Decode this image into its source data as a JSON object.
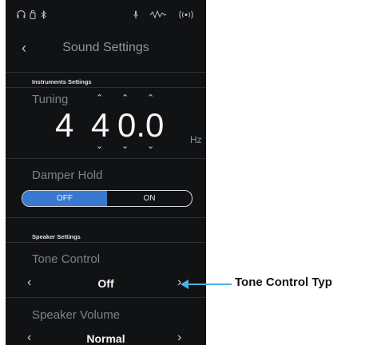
{
  "status_bar": {
    "icons": [
      "headphones-icon",
      "usb-icon",
      "bluetooth-icon",
      "microphone-icon",
      "sound-mode-icon",
      "wireless-icon"
    ]
  },
  "header": {
    "title": "Sound Settings",
    "back_icon": "chevron-left-icon"
  },
  "instruments_settings": {
    "section_label": "Instruments Settings",
    "tuning": {
      "label": "Tuning",
      "digits": [
        "4",
        "4",
        "0.0"
      ],
      "unit": "Hz"
    },
    "damper_hold": {
      "label": "Damper Hold",
      "options": [
        "OFF",
        "ON"
      ],
      "selected": "OFF"
    }
  },
  "speaker_settings": {
    "section_label": "Speaker Settings",
    "tone_control": {
      "label": "Tone Control",
      "value": "Off"
    },
    "speaker_volume": {
      "label": "Speaker Volume",
      "value": "Normal"
    }
  },
  "annotation": {
    "text": "Tone Control Typ"
  },
  "colors": {
    "accent": "#3a78d0",
    "callout": "#47b3e6",
    "background": "#111214"
  }
}
